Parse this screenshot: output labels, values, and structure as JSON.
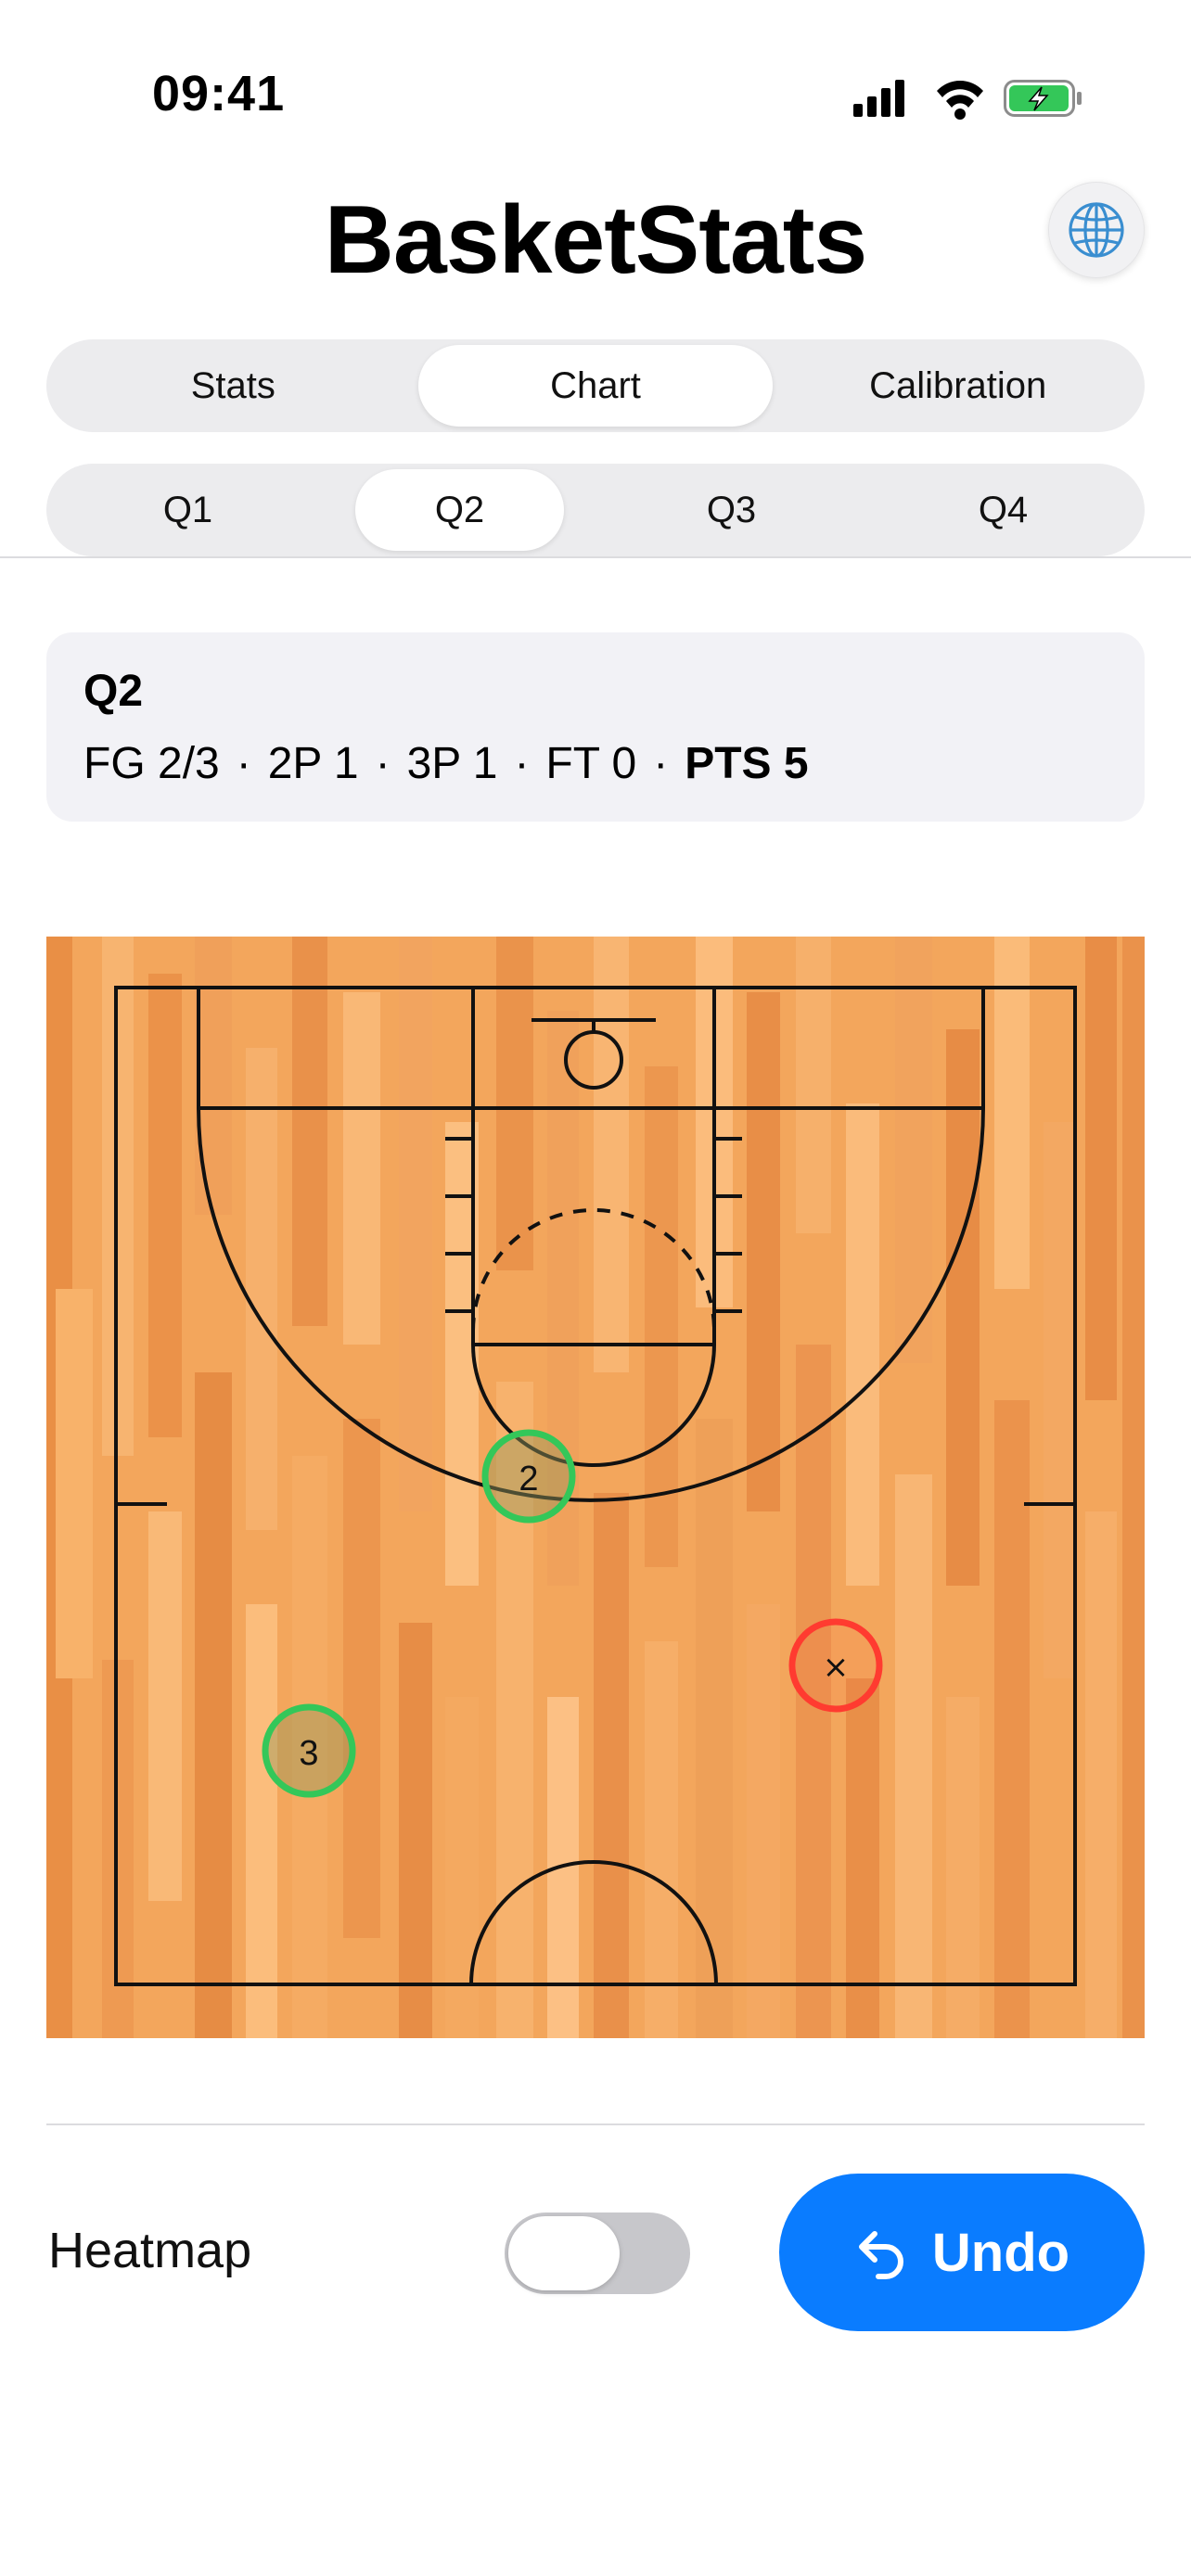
{
  "status_bar": {
    "time": "09:41"
  },
  "header": {
    "title": "BasketStats",
    "language_icon": "globe-icon"
  },
  "main_tabs": [
    {
      "label": "Stats",
      "active": false
    },
    {
      "label": "Chart",
      "active": true
    },
    {
      "label": "Calibration",
      "active": false
    }
  ],
  "quarter_tabs": [
    {
      "label": "Q1",
      "active": false
    },
    {
      "label": "Q2",
      "active": true
    },
    {
      "label": "Q3",
      "active": false
    },
    {
      "label": "Q4",
      "active": false
    }
  ],
  "summary": {
    "title": "Q2",
    "fg": "FG 2/3",
    "two_pt": "2P 1",
    "three_pt": "3P 1",
    "ft": "FT 0",
    "pts": "PTS 5",
    "separator": "·"
  },
  "shots": [
    {
      "label": "2",
      "result": "made"
    },
    {
      "label": "×",
      "result": "missed"
    },
    {
      "label": "3",
      "result": "made"
    }
  ],
  "colors": {
    "made": "#34c759",
    "missed": "#ff3b30",
    "accent": "#0a7cff",
    "battery": "#34c759"
  },
  "controls": {
    "heatmap_label": "Heatmap",
    "heatmap_on": false,
    "undo_label": "Undo"
  }
}
